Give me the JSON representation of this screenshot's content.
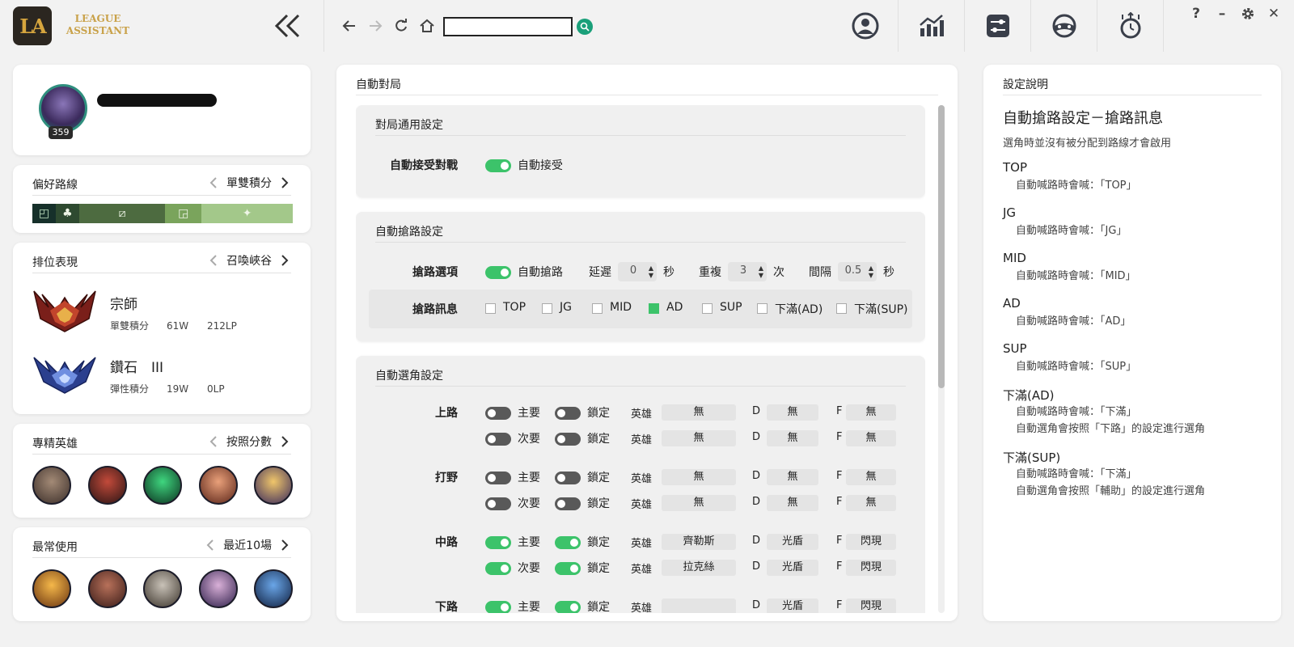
{
  "app": {
    "logo_mark": "LA",
    "logo_line1": "LEAGUE",
    "logo_line2": "ASSISTANT"
  },
  "topbar": {
    "url_value": "",
    "icons": [
      "double-chevron-left-icon",
      "back-icon",
      "forward-icon",
      "refresh-icon",
      "home-icon",
      "search-icon",
      "profile-icon",
      "stats-icon",
      "sliders-icon",
      "gamepad-icon",
      "clock-upgrade-icon"
    ],
    "help_glyph": "?",
    "minimize_glyph": "–",
    "close_glyph": "✕"
  },
  "profile": {
    "level": "359"
  },
  "lane": {
    "title": "偏好路線",
    "mode": "單雙積分",
    "segments": [
      {
        "icon": "top-lane-icon",
        "color": "#16302a",
        "share": 0.09
      },
      {
        "icon": "jungle-icon",
        "color": "#2e4a30",
        "share": 0.09
      },
      {
        "icon": "mid-lane-icon",
        "color": "#4d6b40",
        "share": 0.33
      },
      {
        "icon": "bot-lane-icon",
        "color": "#7aa45c",
        "share": 0.14
      },
      {
        "icon": "support-icon",
        "color": "#a3c88a",
        "share": 0.35
      }
    ]
  },
  "rank": {
    "title": "排位表現",
    "mode": "召喚峽谷",
    "entries": [
      {
        "tier": "宗師",
        "queue": "單雙積分",
        "wins": "61W",
        "lp": "212LP",
        "emblem": "grandmaster-emblem-icon"
      },
      {
        "tier": "鑽石　III",
        "queue": "彈性積分",
        "wins": "19W",
        "lp": "0LP",
        "emblem": "diamond-emblem-icon"
      }
    ]
  },
  "mastery": {
    "title": "專精英雄",
    "mode": "按照分數",
    "champions": [
      "champion-icon-1",
      "champion-icon-2",
      "champion-icon-3",
      "champion-icon-4",
      "champion-icon-5"
    ]
  },
  "recent": {
    "title": "最常使用",
    "mode": "最近10場",
    "champions": [
      "champion-icon-6",
      "champion-icon-7",
      "champion-icon-8",
      "champion-icon-9",
      "champion-icon-10"
    ]
  },
  "center": {
    "title": "自動對局",
    "general": {
      "title": "對局通用設定",
      "row_label": "自動接受對戰",
      "toggle_label": "自動接受",
      "toggle_on": true
    },
    "lane_call": {
      "title": "自動搶路設定",
      "opt_label": "搶路選項",
      "toggle_label": "自動搶路",
      "toggle_on": true,
      "delay_label": "延遲",
      "delay_value": "0",
      "delay_unit": "秒",
      "repeat_label": "重複",
      "repeat_value": "3",
      "repeat_unit": "次",
      "interval_label": "間隔",
      "interval_value": "0.5",
      "interval_unit": "秒",
      "msg_label": "搶路訊息",
      "messages": [
        {
          "label": "TOP",
          "checked": false
        },
        {
          "label": "JG",
          "checked": false
        },
        {
          "label": "MID",
          "checked": false
        },
        {
          "label": "AD",
          "checked": true
        },
        {
          "label": "SUP",
          "checked": false
        },
        {
          "label": "下滿(AD)",
          "checked": false
        },
        {
          "label": "下滿(SUP)",
          "checked": false
        }
      ]
    },
    "pick": {
      "title": "自動選角設定",
      "primary": "主要",
      "secondary": "次要",
      "lock": "鎖定",
      "champ_label": "英雄",
      "d_label": "D",
      "f_label": "F",
      "lanes": [
        {
          "name": "上路",
          "rows": [
            {
              "on": false,
              "lock": false,
              "champ": "無",
              "d": "無",
              "f": "無"
            },
            {
              "on": false,
              "lock": false,
              "champ": "無",
              "d": "無",
              "f": "無"
            }
          ]
        },
        {
          "name": "打野",
          "rows": [
            {
              "on": false,
              "lock": false,
              "champ": "無",
              "d": "無",
              "f": "無"
            },
            {
              "on": false,
              "lock": false,
              "champ": "無",
              "d": "無",
              "f": "無"
            }
          ]
        },
        {
          "name": "中路",
          "rows": [
            {
              "on": true,
              "lock": true,
              "champ": "齊勒斯",
              "d": "光盾",
              "f": "閃現"
            },
            {
              "on": true,
              "lock": true,
              "champ": "拉克絲",
              "d": "光盾",
              "f": "閃現"
            }
          ]
        },
        {
          "name": "下路",
          "rows": [
            {
              "on": true,
              "lock": true,
              "champ": "",
              "d": "光盾",
              "f": "閃現"
            }
          ]
        }
      ]
    }
  },
  "help": {
    "title": "設定說明",
    "heading": "自動搶路設定－搶路訊息",
    "sub": "選角時並沒有被分配到路線才會啟用",
    "items": [
      {
        "key": "TOP",
        "lines": [
          "自動喊路時會喊：「TOP」"
        ]
      },
      {
        "key": "JG",
        "lines": [
          "自動喊路時會喊：「JG」"
        ]
      },
      {
        "key": "MID",
        "lines": [
          "自動喊路時會喊：「MID」"
        ]
      },
      {
        "key": "AD",
        "lines": [
          "自動喊路時會喊：「AD」"
        ]
      },
      {
        "key": "SUP",
        "lines": [
          "自動喊路時會喊：「SUP」"
        ]
      },
      {
        "key": "下滿(AD)",
        "lines": [
          "自動喊路時會喊：「下滿」",
          "自動選角會按照「下路」的設定進行選角"
        ]
      },
      {
        "key": "下滿(SUP)",
        "lines": [
          "自動喊路時會喊：「下滿」",
          "自動選角會按照「輔助」的設定進行選角"
        ]
      }
    ]
  },
  "colors": {
    "accent_green": "#3cc36a",
    "go_button": "#1aa07a",
    "logo_gold": "#c9a24a"
  }
}
